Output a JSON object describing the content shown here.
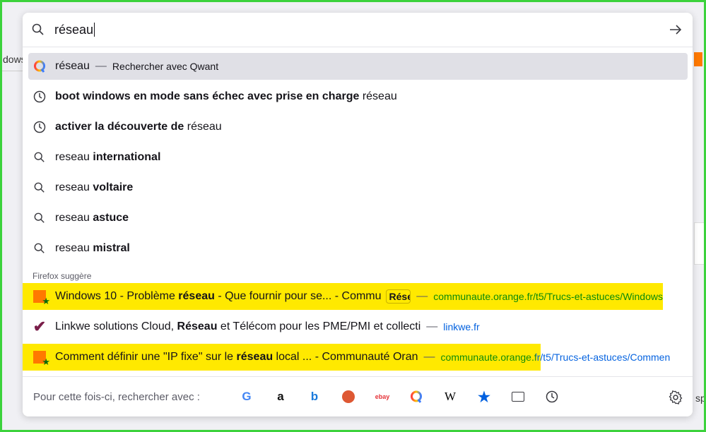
{
  "background": {
    "left_text": "dows",
    "right_text": "spa"
  },
  "search": {
    "query": "réseau"
  },
  "suggestions": [
    {
      "type": "engine",
      "text": "réseau",
      "separator": "—",
      "action": "Rechercher avec Qwant",
      "icon": "qwant-icon"
    },
    {
      "type": "history",
      "bold": "boot windows en mode sans échec avec prise en charge",
      "rest": " réseau",
      "icon": "clock-icon"
    },
    {
      "type": "history",
      "bold": "activer la découverte de",
      "rest": " réseau",
      "icon": "clock-icon"
    },
    {
      "type": "search",
      "plain": "reseau ",
      "bold": "international",
      "icon": "search-icon"
    },
    {
      "type": "search",
      "plain": "reseau ",
      "bold": "voltaire",
      "icon": "search-icon"
    },
    {
      "type": "search",
      "plain": "reseau ",
      "bold": "astuce",
      "icon": "search-icon"
    },
    {
      "type": "search",
      "plain": "reseau ",
      "bold": "mistral",
      "icon": "search-icon"
    }
  ],
  "firefox_suggest": {
    "label": "Firefox suggère",
    "items": [
      {
        "t1": "Windows 10 - Problème ",
        "b": "réseau",
        "t2": " - Que fournir pour se... - Commu",
        "badge": "Réseau",
        "separator": "—",
        "url": "communaute.orange.fr/t5/Trucs-et-astuces/Windows",
        "highlighted": true
      },
      {
        "t1": "Linkwe solutions Cloud, ",
        "b": "Réseau",
        "t2": " et Télécom pour les PME/PMI et collecti",
        "separator": "—",
        "url": "linkwe.fr",
        "highlighted": false
      },
      {
        "t1": "Comment définir une \"IP fixe\" sur le ",
        "b": "réseau",
        "t2": " local ... - Communauté Oran",
        "separator": "—",
        "url": "communaute.orange.fr/t5/Trucs-et-astuces/Commen",
        "highlighted": true
      }
    ]
  },
  "footer": {
    "label": "Pour cette fois-ci, rechercher avec :",
    "engines": [
      "Google",
      "Amazon",
      "Bing",
      "DuckDuckGo",
      "eBay",
      "Qwant",
      "Wikipedia",
      "Bookmarks",
      "Tabs",
      "History"
    ]
  },
  "colors": {
    "highlight": "#ffe900",
    "url": "#0060df",
    "selected": "#e0e0e6",
    "frame": "#3cd23c"
  }
}
